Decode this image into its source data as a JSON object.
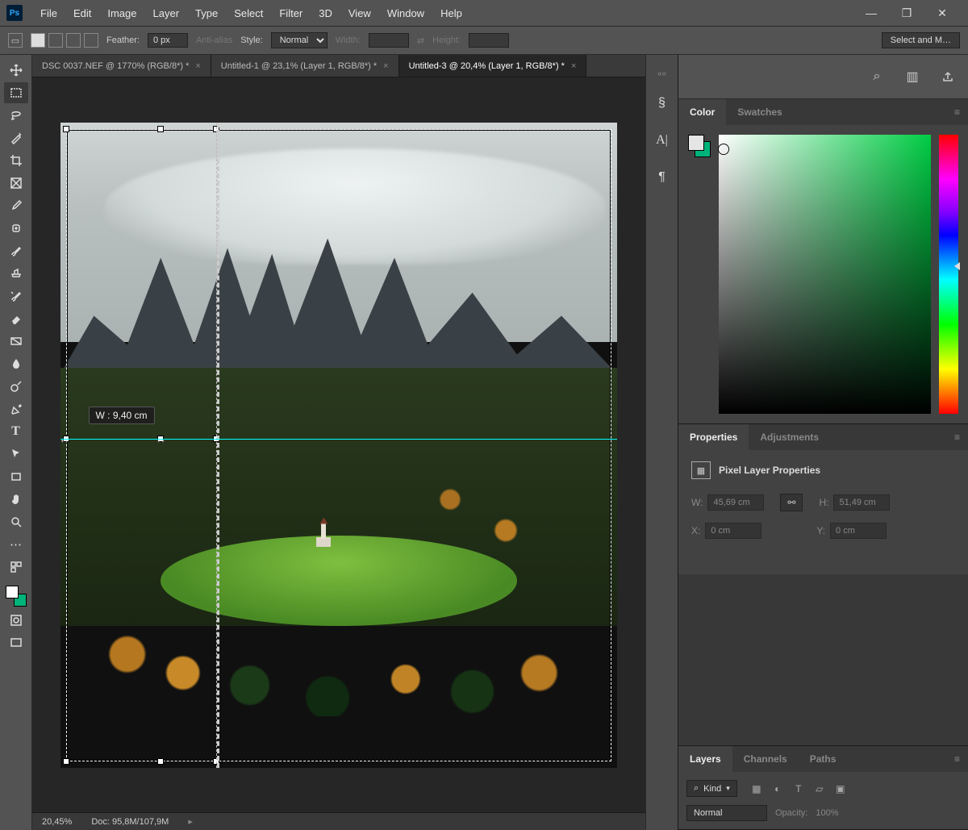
{
  "app": {
    "logo_text": "Ps"
  },
  "menu": [
    "File",
    "Edit",
    "Image",
    "Layer",
    "Type",
    "Select",
    "Filter",
    "3D",
    "View",
    "Window",
    "Help"
  ],
  "options": {
    "feather_label": "Feather:",
    "feather_value": "0 px",
    "antialias_label": "Anti-alias",
    "style_label": "Style:",
    "style_value": "Normal",
    "width_label": "Width:",
    "height_label": "Height:",
    "select_mask": "Select and M…"
  },
  "doc_tabs": [
    {
      "label": "DSC 0037.NEF @ 1770% (RGB/8*) *",
      "active": false
    },
    {
      "label": "Untitled-1 @ 23,1% (Layer 1, RGB/8*) *",
      "active": false
    },
    {
      "label": "Untitled-3 @ 20,4% (Layer 1, RGB/8*) *",
      "active": true
    }
  ],
  "canvas": {
    "tooltip": "W :  9,40 cm",
    "selection": {
      "left_pct": 1,
      "top_pct": 1,
      "width_pct": 22,
      "height_pct": 97
    },
    "guide_h_pct": 49
  },
  "status": {
    "zoom": "20,45%",
    "doc": "Doc: 95,8M/107,9M"
  },
  "iconstrip": [
    "collapse",
    "history",
    "character",
    "paragraph"
  ],
  "right_top_icons": [
    "search",
    "arrange",
    "share"
  ],
  "color_panel": {
    "tabs": [
      "Color",
      "Swatches"
    ],
    "active_tab": "Color",
    "hue_arrow_pct": 47
  },
  "props_panel": {
    "tabs": [
      "Properties",
      "Adjustments"
    ],
    "active_tab": "Properties",
    "title": "Pixel Layer Properties",
    "w_label": "W:",
    "w_value": "45,69 cm",
    "h_label": "H:",
    "h_value": "51,49 cm",
    "x_label": "X:",
    "x_value": "0 cm",
    "y_label": "Y:",
    "y_value": "0 cm"
  },
  "layers_panel": {
    "tabs": [
      "Layers",
      "Channels",
      "Paths"
    ],
    "active_tab": "Layers",
    "search_icon": "⌕",
    "kind_label": "Kind",
    "blend_label": "Normal",
    "opacity_label": "Opacity:",
    "opacity_value": "100%"
  },
  "tools": [
    "move",
    "marquee",
    "lasso",
    "magic-wand",
    "crop",
    "frame",
    "eyedropper",
    "spot-heal",
    "brush",
    "clone",
    "history-brush",
    "eraser",
    "gradient",
    "blur",
    "dodge",
    "pen",
    "type",
    "path-select",
    "rectangle",
    "hand",
    "zoom",
    "more",
    "edit-toolbar"
  ]
}
